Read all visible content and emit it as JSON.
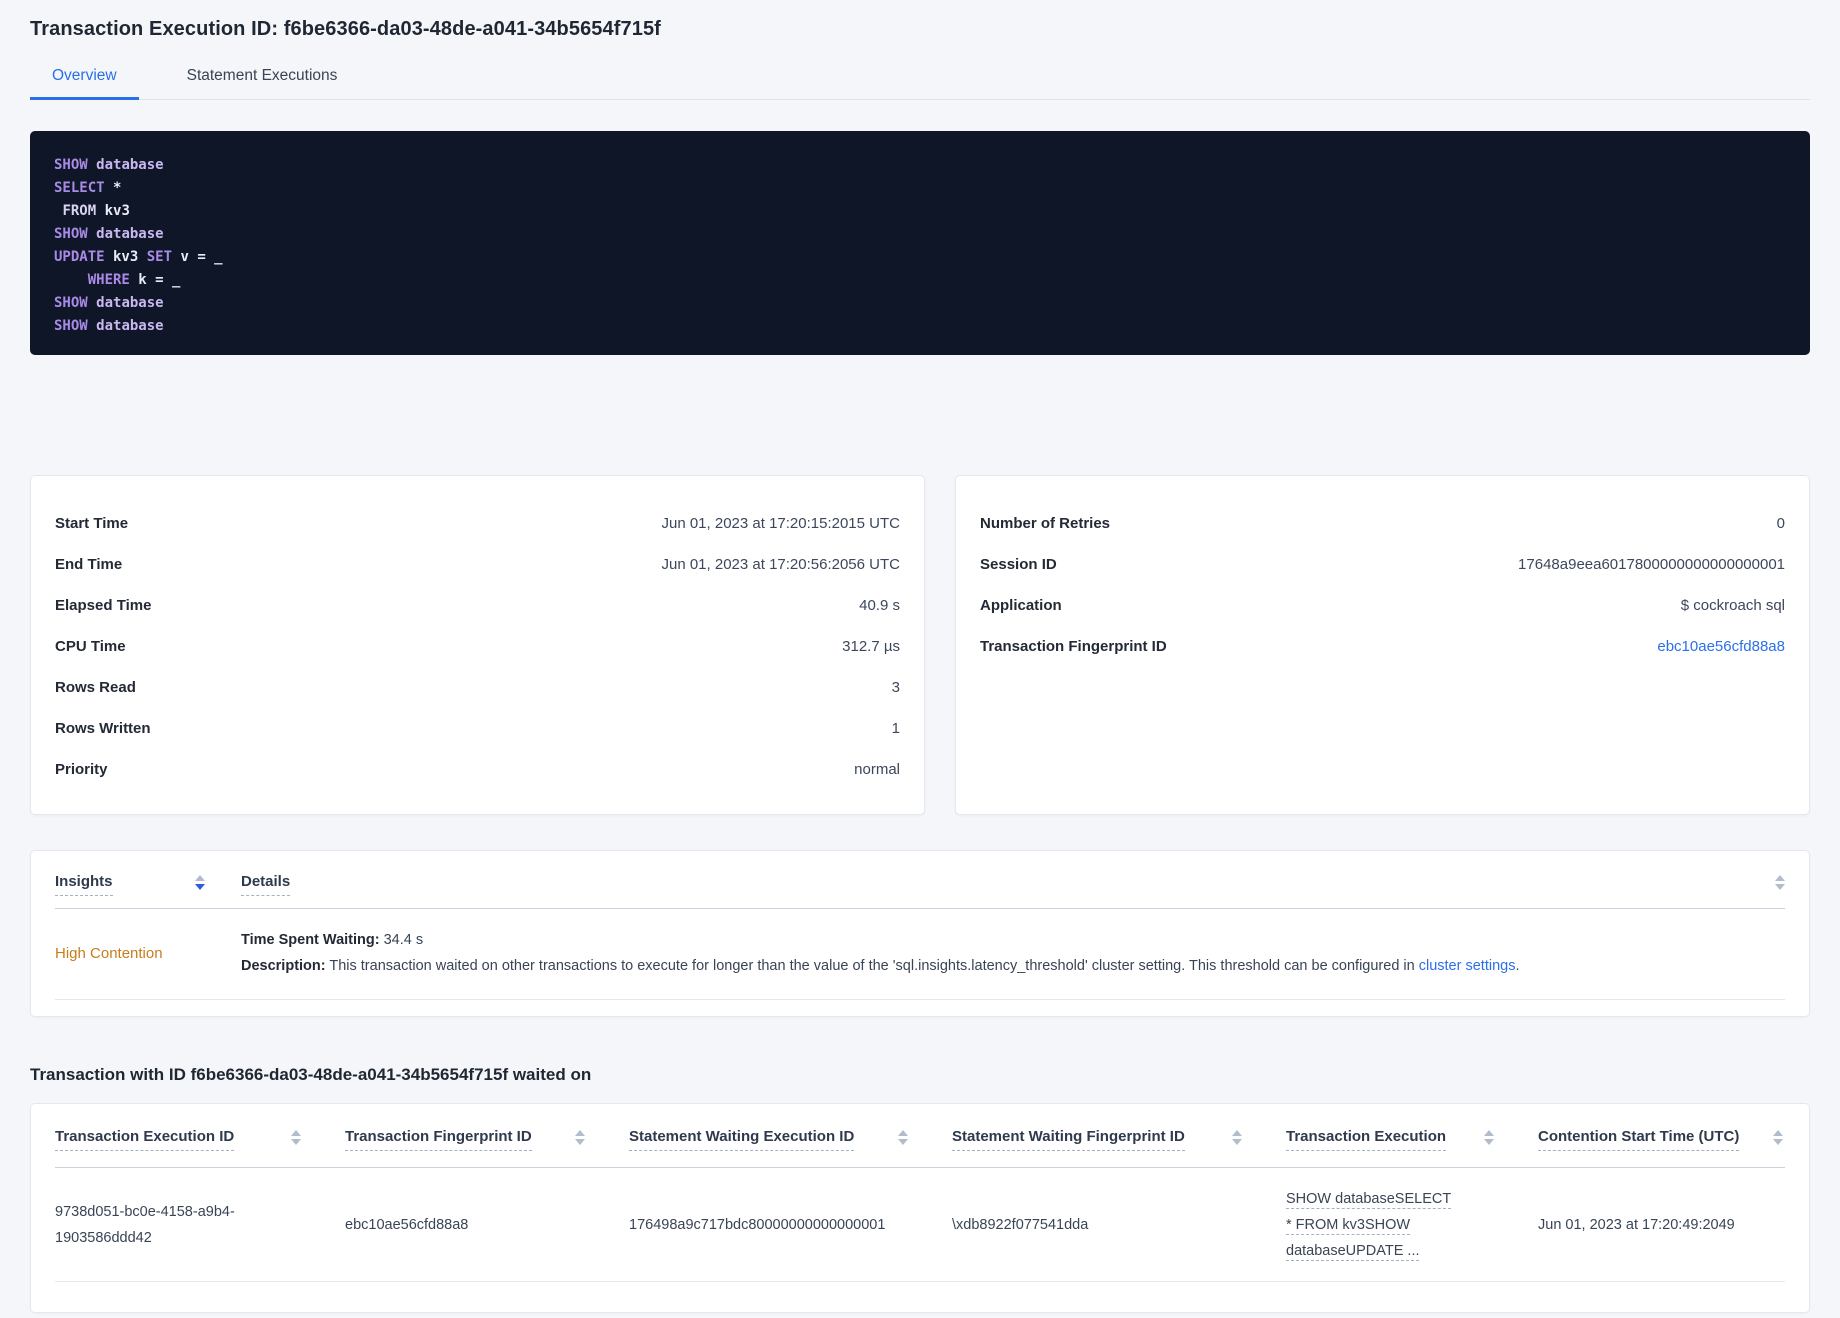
{
  "page": {
    "title": "Transaction Execution ID: f6be6366-da03-48de-a041-34b5654f715f"
  },
  "tabs": [
    {
      "label": "Overview",
      "active": true
    },
    {
      "label": "Statement Executions",
      "active": false
    }
  ],
  "sql_block": {
    "lines": [
      [
        {
          "t": "SHOW",
          "c": "kw"
        },
        {
          "t": " ",
          "c": "p"
        },
        {
          "t": "database",
          "c": "db"
        }
      ],
      [
        {
          "t": "SELECT",
          "c": "kw"
        },
        {
          "t": " *",
          "c": "p"
        }
      ],
      [
        {
          "t": " ",
          "c": "p"
        },
        {
          "t": "FROM",
          "c": "from"
        },
        {
          "t": " kv3",
          "c": "p"
        }
      ],
      [
        {
          "t": "SHOW",
          "c": "kw"
        },
        {
          "t": " ",
          "c": "p"
        },
        {
          "t": "database",
          "c": "db"
        }
      ],
      [
        {
          "t": "UPDATE",
          "c": "kw"
        },
        {
          "t": " kv3 ",
          "c": "p"
        },
        {
          "t": "SET",
          "c": "kw"
        },
        {
          "t": " v = _",
          "c": "p"
        }
      ],
      [
        {
          "t": "    ",
          "c": "p"
        },
        {
          "t": "WHERE",
          "c": "kw"
        },
        {
          "t": " k = _",
          "c": "p"
        }
      ],
      [
        {
          "t": "SHOW",
          "c": "kw"
        },
        {
          "t": " ",
          "c": "p"
        },
        {
          "t": "database",
          "c": "db"
        }
      ],
      [
        {
          "t": "SHOW",
          "c": "kw"
        },
        {
          "t": " ",
          "c": "p"
        },
        {
          "t": "database",
          "c": "db"
        }
      ]
    ]
  },
  "summary_left": {
    "rows": [
      {
        "label": "Start Time",
        "value": "Jun 01, 2023 at 17:20:15:2015 UTC"
      },
      {
        "label": "End Time",
        "value": "Jun 01, 2023 at 17:20:56:2056 UTC"
      },
      {
        "label": "Elapsed Time",
        "value": "40.9 s"
      },
      {
        "label": "CPU Time",
        "value": "312.7 µs"
      },
      {
        "label": "Rows Read",
        "value": "3"
      },
      {
        "label": "Rows Written",
        "value": "1"
      },
      {
        "label": "Priority",
        "value": "normal"
      }
    ]
  },
  "summary_right": {
    "rows": [
      {
        "label": "Number of Retries",
        "value": "0"
      },
      {
        "label": "Session ID",
        "value": "17648a9eea6017800000000000000001"
      },
      {
        "label": "Application",
        "value": "$ cockroach sql"
      },
      {
        "label": "Transaction Fingerprint ID",
        "value": "ebc10ae56cfd88a8",
        "link": true
      }
    ]
  },
  "insights_table": {
    "columns": [
      {
        "label": "Insights"
      },
      {
        "label": "Details"
      }
    ],
    "row": {
      "insight_label": "High Contention",
      "time_spent_label": "Time Spent Waiting:",
      "time_spent_value": " 34.4 s",
      "description_label": "Description:",
      "description_text": " This transaction waited on other transactions to execute for longer than the value of the 'sql.insights.latency_threshold' cluster setting. This threshold can be configured in ",
      "description_link": "cluster settings",
      "description_suffix": "."
    }
  },
  "waited_on": {
    "heading": "Transaction with ID f6be6366-da03-48de-a041-34b5654f715f waited on",
    "columns": [
      "Transaction Execution ID",
      "Transaction Fingerprint ID",
      "Statement Waiting Execution ID",
      "Statement Waiting Fingerprint ID",
      "Transaction Execution",
      "Contention Start Time (UTC)"
    ],
    "row": {
      "transaction_execution_id": "9738d051-bc0e-4158-a9b4-1903586ddd42",
      "transaction_fingerprint_id": "ebc10ae56cfd88a8",
      "statement_waiting_execution_id": "176498a9c717bdc80000000000000001",
      "statement_waiting_fingerprint_id": "\\xdb8922f077541dda",
      "transaction_execution": "SHOW databaseSELECT * FROM kv3SHOW databaseUPDATE ...",
      "contention_start_time": "Jun 01, 2023 at 17:20:49:2049"
    }
  },
  "colors": {
    "accent_blue": "#2b6fe8",
    "insight_orange": "#c77d1a",
    "sql_background": "#0e1628",
    "sql_keyword": "#a98ae6",
    "page_background": "#f4f6fa"
  }
}
